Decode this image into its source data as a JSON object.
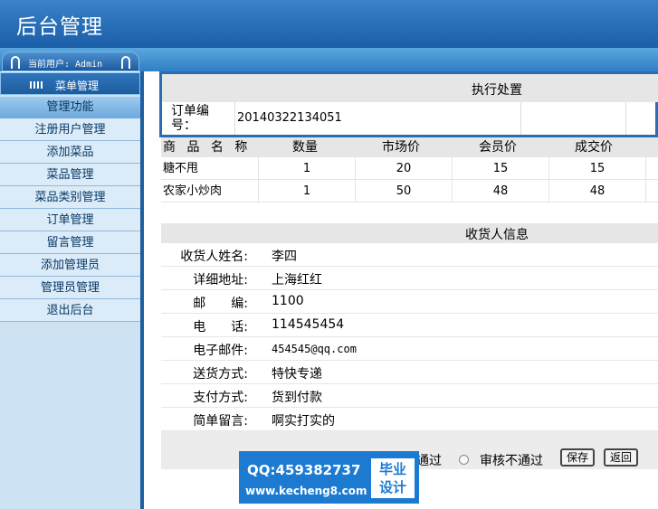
{
  "header": {
    "title": "后台管理"
  },
  "user": {
    "label": "当前用户: Admin"
  },
  "menu_head": {
    "label": "菜单管理"
  },
  "sidebar": {
    "section": "管理功能",
    "items": [
      {
        "label": "注册用户管理"
      },
      {
        "label": "添加菜品"
      },
      {
        "label": "菜品管理"
      },
      {
        "label": "菜品类别管理"
      },
      {
        "label": "订单管理"
      },
      {
        "label": "留言管理"
      },
      {
        "label": "添加管理员"
      },
      {
        "label": "管理员管理"
      },
      {
        "label": "退出后台"
      }
    ]
  },
  "order": {
    "header": "执行处置",
    "number_label": "订单编号：",
    "number_value": "20140322134051"
  },
  "goods": {
    "columns": [
      "商 品 名 称",
      "数量",
      "市场价",
      "会员价",
      "成交价"
    ],
    "rows": [
      [
        "糖不甩",
        "1",
        "20",
        "15",
        "15"
      ],
      [
        "农家小炒肉",
        "1",
        "50",
        "48",
        "48"
      ]
    ]
  },
  "receiver": {
    "header": "收货人信息",
    "fields": [
      {
        "label": "收货人姓名:",
        "value": "李四"
      },
      {
        "label": "详细地址:",
        "value": "上海红红"
      },
      {
        "label": "邮　　编:",
        "value": "1100"
      },
      {
        "label": "电　　话:",
        "value": "114545454"
      },
      {
        "label": "电子邮件:",
        "value": "454545@qq.com"
      },
      {
        "label": "送货方式:",
        "value": "特快专递"
      },
      {
        "label": "支付方式:",
        "value": "货到付款"
      },
      {
        "label": "简单留言:",
        "value": "啊实打实的"
      }
    ]
  },
  "actions": {
    "approve_label": "通过",
    "reject_label": "审核不通过",
    "save_label": "保存",
    "back_label": "返回"
  },
  "watermark": {
    "qq": "QQ:459382737",
    "url": "www.kecheng8.com",
    "tag_line1": "毕业",
    "tag_line2": "设计"
  }
}
